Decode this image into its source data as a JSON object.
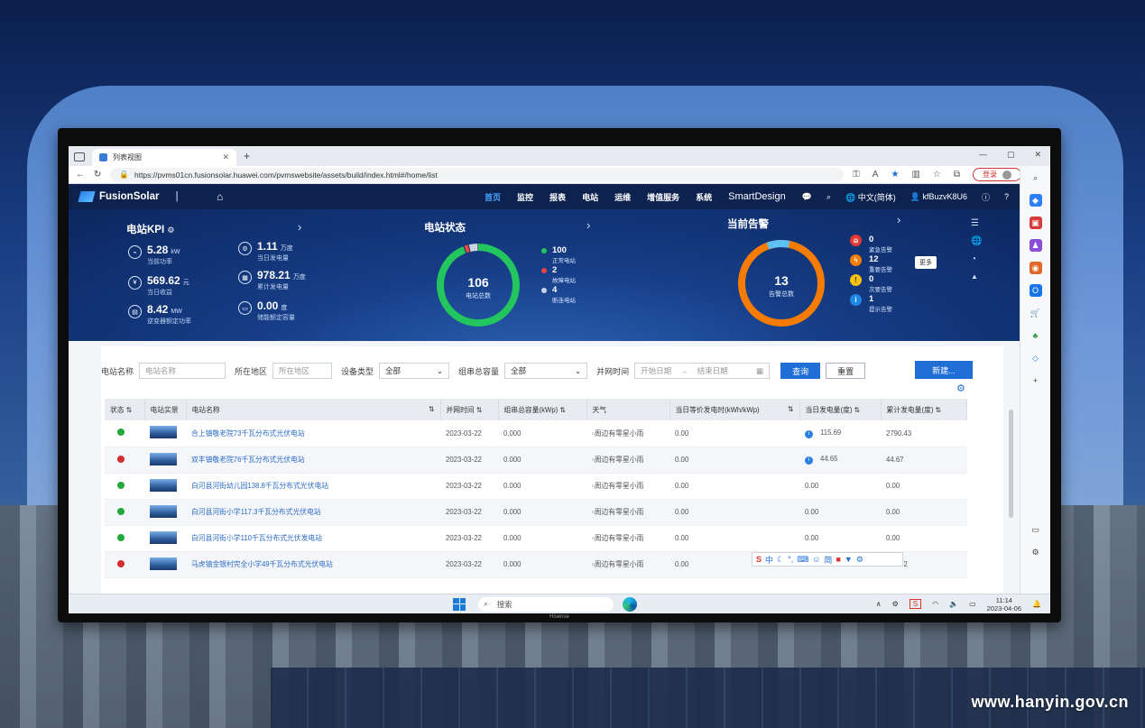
{
  "watermark": "www.hanyin.gov.cn",
  "monitor_brand": "Hisense",
  "browser": {
    "tab_title": "列表视图",
    "url": "https://pvms01cn.fusionsolar.huawei.com/pvmswebsite/assets/build/index.html#/home/list",
    "login_label": "登录"
  },
  "nav": {
    "logo": "FusionSolar",
    "items": [
      "首页",
      "监控",
      "报表",
      "电站",
      "运维",
      "增值服务",
      "系统"
    ],
    "smartdesign": "SmartDesign",
    "language": "中文(简体)",
    "user": "kfBuzvK8U6"
  },
  "kpi": {
    "title": "电站KPI",
    "items": [
      {
        "value": "5.28",
        "unit": "kW",
        "label": "当前功率"
      },
      {
        "value": "569.62",
        "unit": "元",
        "label": "当日收益"
      },
      {
        "value": "8.42",
        "unit": "MW",
        "label": "逆变器额定功率"
      },
      {
        "value": "1.11",
        "unit": "万度",
        "label": "当日发电量"
      },
      {
        "value": "978.21",
        "unit": "万度",
        "label": "累计发电量"
      },
      {
        "value": "0.00",
        "unit": "度",
        "label": "储能额定容量"
      }
    ]
  },
  "station_status": {
    "title": "电站状态",
    "total": 106,
    "total_label": "电站总数",
    "normal": {
      "value": 100,
      "label": "正常电站",
      "color": "#22c55e"
    },
    "fault": {
      "value": 2,
      "label": "故障电站",
      "color": "#ef4444"
    },
    "offline": {
      "value": 4,
      "label": "断连电站",
      "color": "#cbd5e1"
    }
  },
  "alarms": {
    "title": "当前告警",
    "total": 13,
    "total_label": "告警总数",
    "tooltip": "更多",
    "items": [
      {
        "value": "0",
        "label": "紧急告警",
        "color": "#e53935",
        "icon": "alarm-bell-icon"
      },
      {
        "value": "12",
        "label": "重要告警",
        "color": "#f57c00",
        "icon": "lightning-icon"
      },
      {
        "value": "0",
        "label": "次要告警",
        "color": "#f9c20a",
        "icon": "exclamation-icon"
      },
      {
        "value": "1",
        "label": "提示告警",
        "color": "#1e88e5",
        "icon": "info-icon"
      }
    ]
  },
  "filters": {
    "name_label": "电站名称",
    "name_placeholder": "电站名称",
    "region_label": "所在地区",
    "region_placeholder": "所在地区",
    "device_label": "设备类型",
    "device_value": "全部",
    "capacity_label": "组串总容量",
    "capacity_value": "全部",
    "date_label": "并网时间",
    "start_placeholder": "开始日期",
    "end_placeholder": "结束日期",
    "query": "查询",
    "reset": "重置",
    "new": "新建..."
  },
  "table": {
    "headers": [
      "状态",
      "电站实景",
      "电站名称",
      "并网时间",
      "组串总容量(kWp)",
      "天气",
      "当日等价发电时(kWh/kWp)",
      "当日发电量(度)",
      "累计发电量(度)"
    ],
    "rows": [
      {
        "status": "green",
        "name": "合上镇敬老院73千瓦分布式光伏电站",
        "date": "2023-03-22",
        "capacity": "0.000",
        "weather": "周边有零星小雨",
        "hours": "0.00",
        "info": true,
        "daily": "115.69",
        "total": "2790.43"
      },
      {
        "status": "red",
        "name": "双丰镇敬老院76千瓦分布式光伏电站",
        "date": "2023-03-22",
        "capacity": "0.000",
        "weather": "周边有零星小雨",
        "hours": "0.00",
        "info": true,
        "daily": "44.65",
        "total": "44.67"
      },
      {
        "status": "green",
        "name": "白河县河街幼儿园138.8千瓦分布式光伏电站",
        "date": "2023-03-22",
        "capacity": "0.000",
        "weather": "周边有零星小雨",
        "hours": "0.00",
        "info": false,
        "daily": "0.00",
        "total": "0.00"
      },
      {
        "status": "green",
        "name": "白河县河街小学117.3千瓦分布式光伏电站",
        "date": "2023-03-22",
        "capacity": "0.000",
        "weather": "周边有零星小雨",
        "hours": "0.00",
        "info": false,
        "daily": "0.00",
        "total": "0.00"
      },
      {
        "status": "green",
        "name": "白河县河街小学110千瓦分布式光伏发电站",
        "date": "2023-03-22",
        "capacity": "0.000",
        "weather": "周边有零星小雨",
        "hours": "0.00",
        "info": false,
        "daily": "0.00",
        "total": "0.00"
      },
      {
        "status": "red",
        "name": "马虎镇金银村完全小学49千瓦分布式光伏电站",
        "date": "2023-03-22",
        "capacity": "0.000",
        "weather": "周边有零星小雨",
        "hours": "0.00",
        "info": false,
        "daily": "",
        "total": "288.72"
      }
    ]
  },
  "ime": {
    "brand": "S",
    "lang": "中",
    "simp": "简"
  },
  "taskbar": {
    "search": "搜索",
    "time": "11:14",
    "date": "2023-04-06"
  },
  "colors": {
    "accent": "#1f6fd6",
    "nav_bg": "#0e2250",
    "status_green": "#22a93a",
    "status_red": "#d32f2f",
    "alarm_ring": "#f57c00"
  }
}
